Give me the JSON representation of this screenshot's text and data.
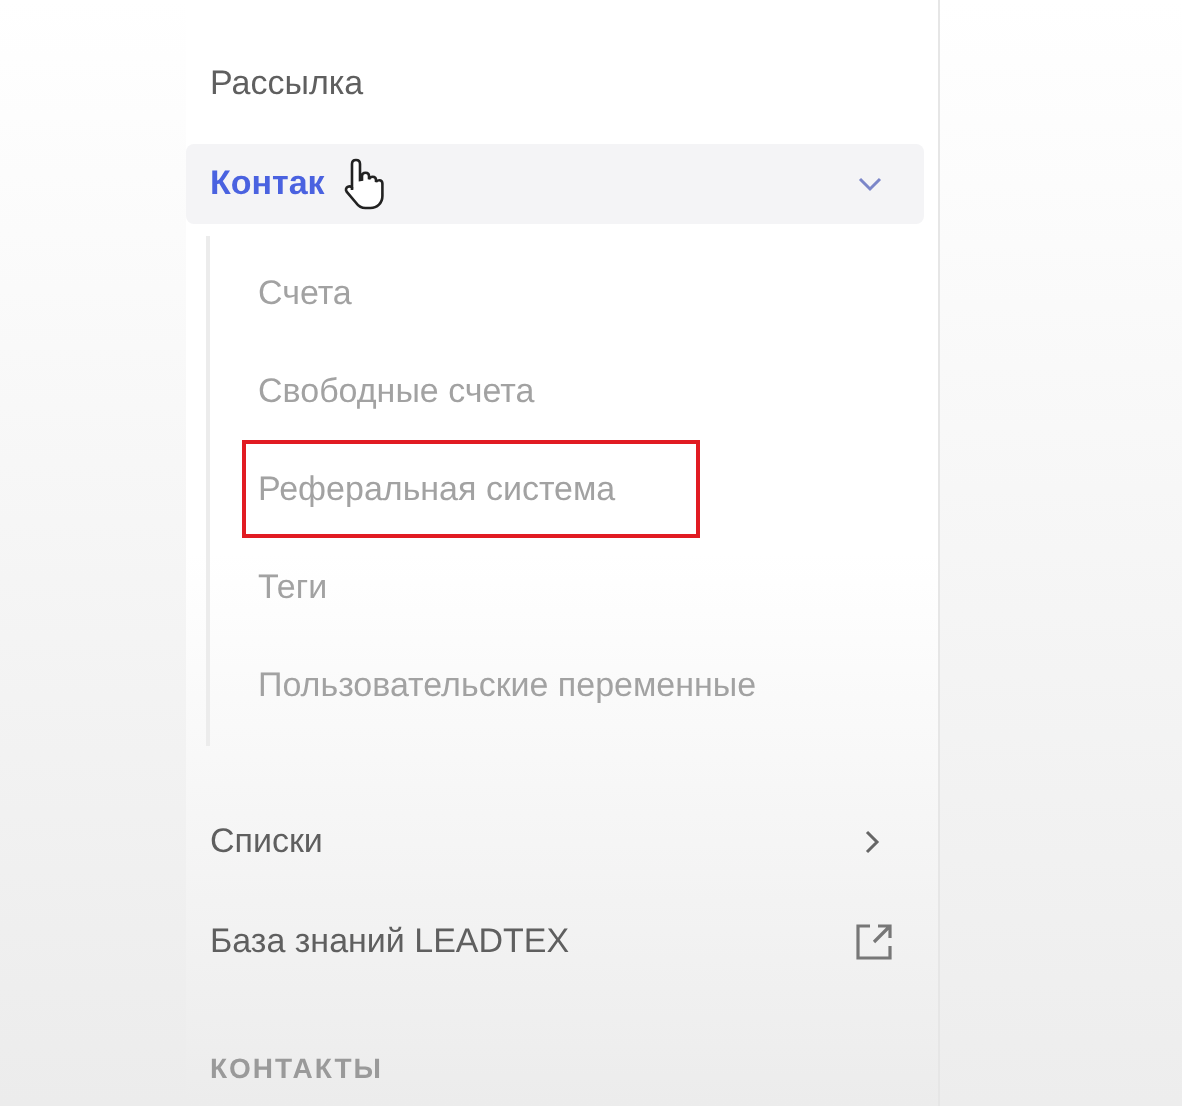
{
  "sidebar": {
    "items": [
      {
        "label": "Рассылка",
        "kind": "plain"
      },
      {
        "label": "Контак",
        "kind": "group",
        "expanded": true,
        "selected": true,
        "children": [
          {
            "label": "Счета",
            "marked": false
          },
          {
            "label": "Свободные счета",
            "marked": false
          },
          {
            "label": "Реферальная система",
            "marked": true
          },
          {
            "label": "Теги",
            "marked": false
          },
          {
            "label": "Пользовательские переменные",
            "marked": false
          }
        ]
      },
      {
        "label": "Списки",
        "kind": "submenu"
      },
      {
        "label": "База знаний LEADTEX",
        "kind": "external"
      }
    ],
    "section_heading": "КОНТАКТЫ"
  }
}
